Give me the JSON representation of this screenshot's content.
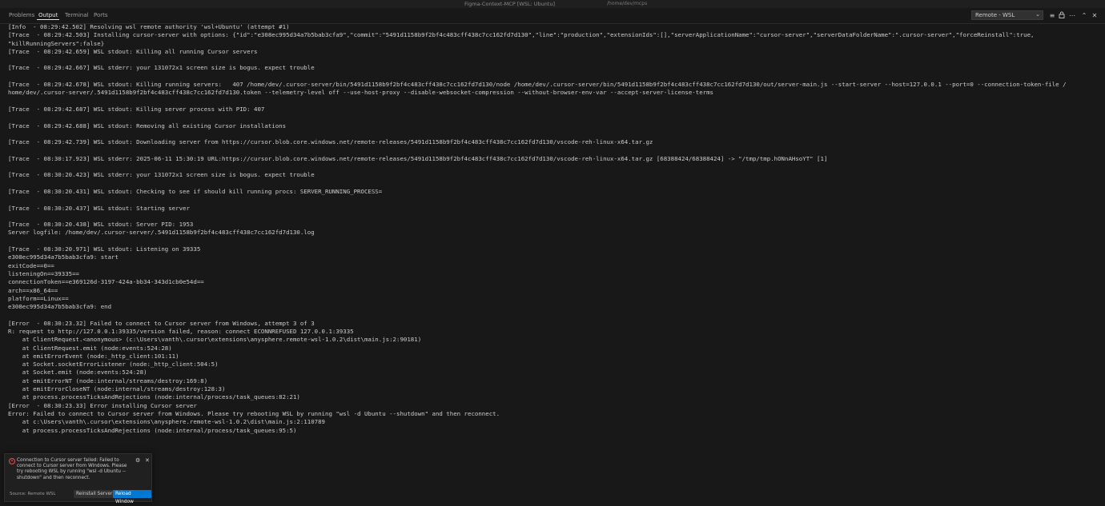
{
  "window": {
    "title": "Figma-Context-MCP [WSL: Ubuntu]",
    "path": "/home/dev/mcps"
  },
  "panel": {
    "tabs": [
      "Problems",
      "Output",
      "Terminal",
      "Ports"
    ],
    "active_tab": "Output",
    "channel_select": "Remote - WSL"
  },
  "output_lines": [
    "[Info  - 08:29:42.502] Resolving wsl remote authority 'wsl+Ubuntu' (attempt #1)",
    "[Trace  - 08:29:42.503] Installing cursor-server with options: {\"id\":\"e308ec995d34a7b5bab3cfa9\",\"commit\":\"5491d1158b9f2bf4c483cff438c7cc162fd7d130\",\"line\":\"production\",\"extensionIds\":[],\"serverApplicationName\":\"cursor-server\",\"serverDataFolderName\":\".cursor-server\",\"forceReinstall\":true,",
    "\"killRunningServers\":false}",
    "[Trace  - 08:29:42.659] WSL stdout: Killing all running Cursor servers",
    "",
    "[Trace  - 08:29:42.667] WSL stderr: your 131072x1 screen size is bogus. expect trouble",
    "",
    "[Trace  - 08:29:42.678] WSL stdout: Killing running servers:   407 /home/dev/.cursor-server/bin/5491d1158b9f2bf4c483cff438c7cc162fd7d130/node /home/dev/.cursor-server/bin/5491d1158b9f2bf4c483cff438c7cc162fd7d130/out/server-main.js --start-server --host=127.0.0.1 --port=0 --connection-token-file /",
    "home/dev/.cursor-server/.5491d1158b9f2bf4c483cff438c7cc162fd7d130.token --telemetry-level off --use-host-proxy --disable-websocket-compression --without-browser-env-var --accept-server-license-terms",
    "",
    "[Trace  - 08:29:42.687] WSL stdout: Killing server process with PID: 407",
    "",
    "[Trace  - 08:29:42.688] WSL stdout: Removing all existing Cursor installations",
    "",
    "[Trace  - 08:29:42.739] WSL stdout: Downloading server from https://cursor.blob.core.windows.net/remote-releases/5491d1158b9f2bf4c483cff438c7cc162fd7d130/vscode-reh-linux-x64.tar.gz",
    "",
    "[Trace  - 08:30:17.923] WSL stderr: 2025-06-11 15:30:19 URL:https://cursor.blob.core.windows.net/remote-releases/5491d1158b9f2bf4c483cff438c7cc162fd7d130/vscode-reh-linux-x64.tar.gz [68388424/68388424] -> \"/tmp/tmp.hONnAHsoYT\" [1]",
    "",
    "[Trace  - 08:30:20.423] WSL stderr: your 131072x1 screen size is bogus. expect trouble",
    "",
    "[Trace  - 08:30:20.431] WSL stdout: Checking to see if should kill running procs: SERVER_RUNNING_PROCESS=",
    "",
    "[Trace  - 08:30:20.437] WSL stdout: Starting server",
    "",
    "[Trace  - 08:30:20.438] WSL stdout: Server PID: 1953",
    "Server logfile: /home/dev/.cursor-server/.5491d1158b9f2bf4c483cff438c7cc162fd7d130.log",
    "",
    "[Trace  - 08:30:20.971] WSL stdout: Listening on 39335",
    "e308ec995d34a7b5bab3cfa9: start",
    "exitCode==0==",
    "listeningOn==39335==",
    "connectionToken==e369126d-3197-424a-bb34-343d1cb0e54d==",
    "arch==x86_64==",
    "platform==Linux==",
    "e308ec995d34a7b5bab3cfa9: end",
    "",
    "[Error  - 08:30:23.32] Failed to connect to Cursor server from Windows, attempt 3 of 3",
    "R: request to http://127.0.0.1:39335/version failed, reason: connect ECONNREFUSED 127.0.0.1:39335",
    "    at ClientRequest.<anonymous> (c:\\Users\\vanth\\.cursor\\extensions\\anysphere.remote-wsl-1.0.2\\dist\\main.js:2:90181)",
    "    at ClientRequest.emit (node:events:524:28)",
    "    at emitErrorEvent (node:_http_client:101:11)",
    "    at Socket.socketErrorListener (node:_http_client:504:5)",
    "    at Socket.emit (node:events:524:28)",
    "    at emitErrorNT (node:internal/streams/destroy:169:8)",
    "    at emitErrorCloseNT (node:internal/streams/destroy:128:3)",
    "    at process.processTicksAndRejections (node:internal/process/task_queues:82:21)",
    "[Error  - 08:30:23.33] Error installing Cursor server",
    "Error: Failed to connect to Cursor server from Windows. Please try rebooting WSL by running \"wsl -d Ubuntu --shutdown\" and then reconnect.",
    "    at c:\\Users\\vanth\\.cursor\\extensions\\anysphere.remote-wsl-1.0.2\\dist\\main.js:2:110789",
    "    at process.processTicksAndRejections (node:internal/process/task_queues:95:5)"
  ],
  "notification": {
    "message": "Connection to Cursor server failed: Failed to connect to Cursor server from Windows. Please try rebooting WSL by running \"wsl -d Ubuntu --shutdown\" and then reconnect.",
    "source": "Source: Remote WSL",
    "buttons": [
      "Reinstall Server",
      "Reload Window"
    ]
  },
  "icons": {
    "panel_actions": [
      "list-filter-icon",
      "lock-icon",
      "more-icon",
      "maximize-icon",
      "close-icon"
    ]
  },
  "colors": {
    "background": "#181818",
    "error": "#f14c4c",
    "primary_button": "#0078d4"
  }
}
